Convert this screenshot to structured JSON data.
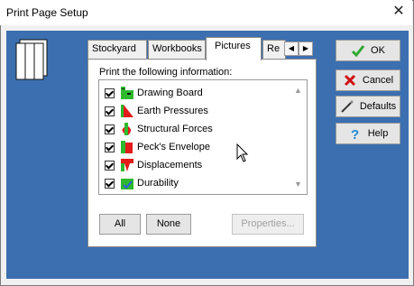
{
  "window": {
    "title": "Print Page Setup",
    "close_symbol": "✕"
  },
  "tabs": [
    {
      "label": "Stockyard",
      "active": false
    },
    {
      "label": "Workbooks",
      "active": false
    },
    {
      "label": "Pictures",
      "active": true
    },
    {
      "label": "Re",
      "active": false
    }
  ],
  "tab_scroll": {
    "left": "◀",
    "right": "▶"
  },
  "panel": {
    "label": "Print the following information:",
    "items": [
      {
        "label": "Drawing Board",
        "checked": true,
        "icon": "drawing-board-icon"
      },
      {
        "label": "Earth Pressures",
        "checked": true,
        "icon": "earth-pressures-icon"
      },
      {
        "label": "Structural Forces",
        "checked": true,
        "icon": "structural-forces-icon"
      },
      {
        "label": "Peck's Envelope",
        "checked": true,
        "icon": "pecks-envelope-icon"
      },
      {
        "label": "Displacements",
        "checked": true,
        "icon": "displacements-icon"
      },
      {
        "label": "Durability",
        "checked": true,
        "icon": "durability-icon"
      }
    ],
    "scroll_up": "▲",
    "scroll_down": "▼",
    "buttons": {
      "all": "All",
      "none": "None",
      "properties": "Properties..."
    }
  },
  "side_buttons": {
    "ok": "OK",
    "cancel": "Cancel",
    "defaults": "Defaults",
    "help": "Help"
  },
  "colors": {
    "client_bg": "#3c6fb0",
    "ok_check": "#2fa82f",
    "cancel_x": "#d01010",
    "help_q": "#1e88d8"
  }
}
